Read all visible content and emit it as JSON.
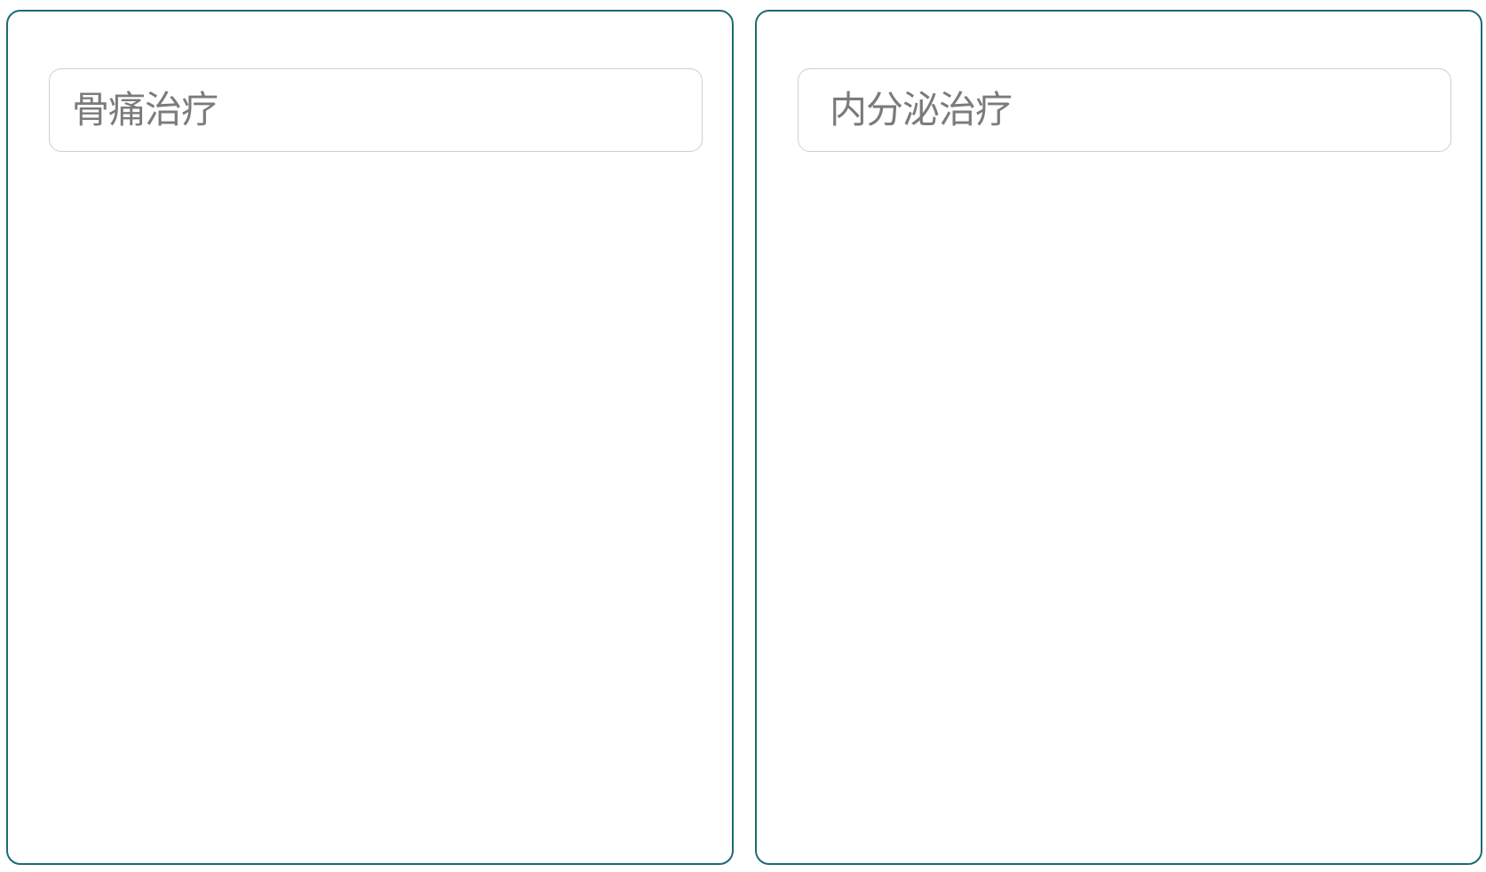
{
  "panels": [
    {
      "field_value": "骨痛治疗"
    },
    {
      "field_value": "内分泌治疗"
    }
  ],
  "colors": {
    "panel_border": "#1b6b72",
    "field_border": "#cfcfcf",
    "field_text": "#7b7b7b",
    "background": "#ffffff"
  }
}
